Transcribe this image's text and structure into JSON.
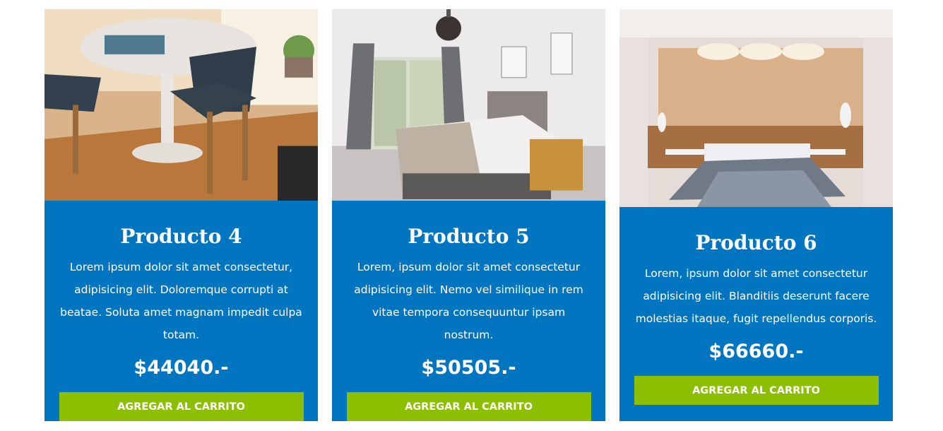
{
  "colors": {
    "card_background": "#0275c1",
    "button_background": "#8cbf00",
    "text": "#ffffff"
  },
  "products": [
    {
      "title": "Producto 4",
      "description": "Lorem ipsum dolor sit amet consectetur, adipisicing elit. Doloremque corrupti at beatae. Soluta amet magnam impedit culpa totam.",
      "price": "$44040.-",
      "button_label": "Agregar al carrito",
      "image": "dining-table-photo"
    },
    {
      "title": "Producto 5",
      "description": "Lorem, ipsum dolor sit amet consectetur adipisicing elit. Nemo vel similique in rem vitae tempora consequuntur ipsam nostrum.",
      "price": "$50505.-",
      "button_label": "Agregar al carrito",
      "image": "bedroom-photo"
    },
    {
      "title": "Producto 6",
      "description": "Lorem, ipsum dolor sit amet consectetur adipisicing elit. Blanditiis deserunt facere molestias itaque, fugit repellendus corporis.",
      "price": "$66660.-",
      "button_label": "Agregar al carrito",
      "image": "wood-bedroom-photo"
    }
  ]
}
